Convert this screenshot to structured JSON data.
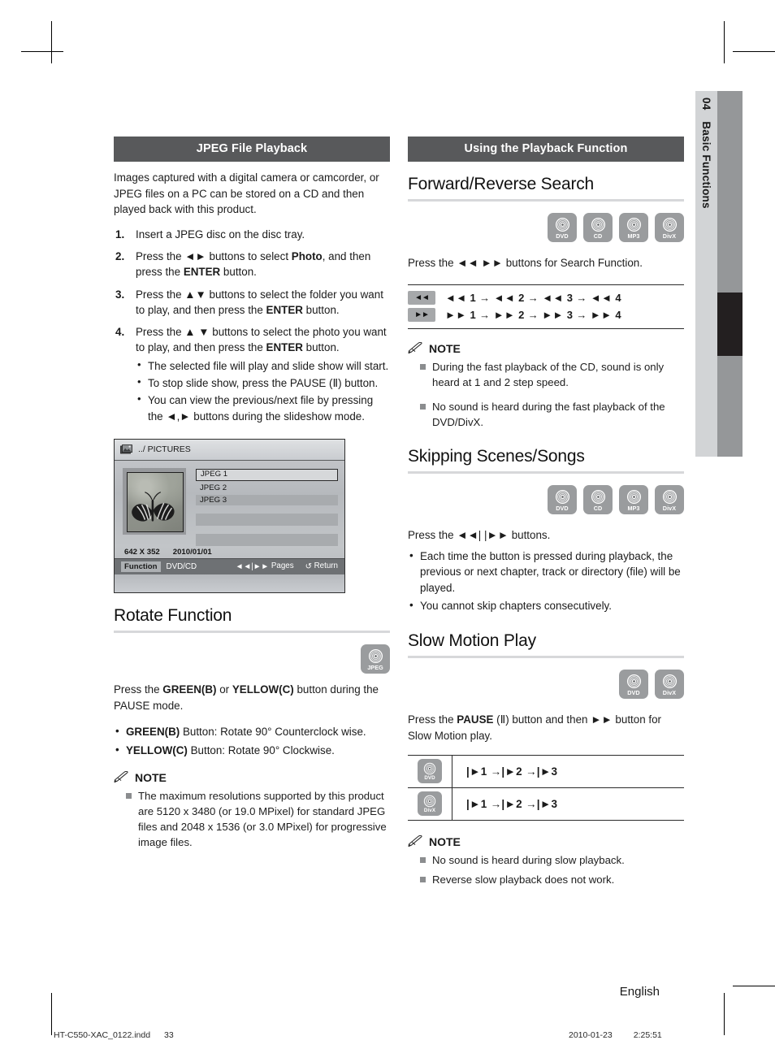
{
  "side_tab": {
    "chapter_number": "04",
    "chapter_title": "Basic Functions"
  },
  "left_column": {
    "banner": "JPEG File Playback",
    "intro": "Images captured with a digital camera or camcorder, or JPEG files on a PC can be stored on a CD and then played back with this product.",
    "steps": [
      {
        "num": "1.",
        "text": "Insert a JPEG disc on the disc tray."
      },
      {
        "num": "2.",
        "text_parts": [
          "Press the ",
          "◄►",
          " buttons to select ",
          "Photo",
          ", and then press the ",
          "ENTER",
          " button."
        ]
      },
      {
        "num": "3.",
        "text_parts": [
          "Press the ",
          "▲▼",
          " buttons to select the folder you want to play, and then press the ",
          "ENTER",
          " button."
        ]
      },
      {
        "num": "4.",
        "text_parts": [
          "Press the ",
          "▲ ▼",
          " buttons to select the photo you want to play, and then press the ",
          "ENTER",
          " button."
        ],
        "sub_bullets": [
          "The selected file will play and slide show will start.",
          "To stop slide show, press the PAUSE (Ⅱ) button.",
          "You can view the previous/next file by pressing the ◄,► buttons during the slideshow mode."
        ]
      }
    ],
    "osd": {
      "path_label": "../ PICTURES",
      "folder_icon": "pictures-folder-icon",
      "files": [
        "JPEG 1",
        "JPEG 2",
        "JPEG 3"
      ],
      "selected_file": "JPEG 1",
      "resolution": "642 X 352",
      "date": "2010/01/01",
      "status_function": "Function",
      "status_source": "DVD/CD",
      "pages_label": "Pages",
      "return_label": "Return",
      "pages_icon": "◄◄|►►",
      "return_icon": "↺"
    },
    "rotate": {
      "heading": "Rotate Function",
      "disc_icons": [
        "JPEG"
      ],
      "intro_parts": [
        "Press the ",
        "GREEN(B)",
        " or ",
        "YELLOW(C)",
        " button during the PAUSE mode."
      ],
      "bullets": [
        {
          "bold": "GREEN(B)",
          "rest": " Button: Rotate 90° Counterclock wise."
        },
        {
          "bold": "YELLOW(C)",
          "rest": " Button: Rotate 90° Clockwise."
        }
      ]
    },
    "note": {
      "title": "NOTE",
      "items": [
        "The maximum resolutions supported by this product are 5120 x 3480 (or 19.0 MPixel) for standard JPEG files and 2048 x 1536 (or 3.0 MPixel) for progressive image files."
      ]
    }
  },
  "right_column": {
    "banner": "Using the Playback Function",
    "search": {
      "heading": "Forward/Reverse Search",
      "disc_icons": [
        "DVD",
        "CD",
        "MP3",
        "DivX"
      ],
      "intro": "Press the ◄◄ ►► buttons for Search Function.",
      "table": [
        {
          "key": "◄◄",
          "sequence": "◄◄ 1 → ◄◄ 2 → ◄◄ 3 → ◄◄ 4"
        },
        {
          "key": "►►",
          "sequence": "►► 1 → ►► 2 → ►► 3 → ►► 4"
        }
      ],
      "note": {
        "title": "NOTE",
        "items": [
          "During the fast playback of the CD, sound is only heard at 1 and 2 step speed.",
          "No sound is heard during the fast playback of the DVD/DivX."
        ]
      }
    },
    "skipping": {
      "heading": "Skipping Scenes/Songs",
      "disc_icons": [
        "DVD",
        "CD",
        "MP3",
        "DivX"
      ],
      "intro": "Press the ◄◄| |►► buttons.",
      "bullets": [
        "Each time the button is pressed during playback, the previous or next chapter, track or directory (file) will be played.",
        "You cannot skip chapters consecutively."
      ]
    },
    "slow_motion": {
      "heading": "Slow Motion Play",
      "disc_icons": [
        "DVD",
        "DivX"
      ],
      "intro_parts": [
        "Press the ",
        "PAUSE",
        " (Ⅱ) button and then ",
        "►►",
        " button for Slow Motion play."
      ],
      "table": [
        {
          "disc": "DVD",
          "sequence": "|►1 →|►2 →|►3"
        },
        {
          "disc": "DivX",
          "sequence": "|►1 →|►2 →|►3"
        }
      ],
      "note": {
        "title": "NOTE",
        "items": [
          "No sound is heard during slow playback.",
          "Reverse slow playback does not work."
        ]
      }
    }
  },
  "footer": {
    "language": "English",
    "file_name": "HT-C550-XAC_0122.indd",
    "page_number": "33",
    "date": "2010-01-23",
    "time": "2:25:51"
  }
}
